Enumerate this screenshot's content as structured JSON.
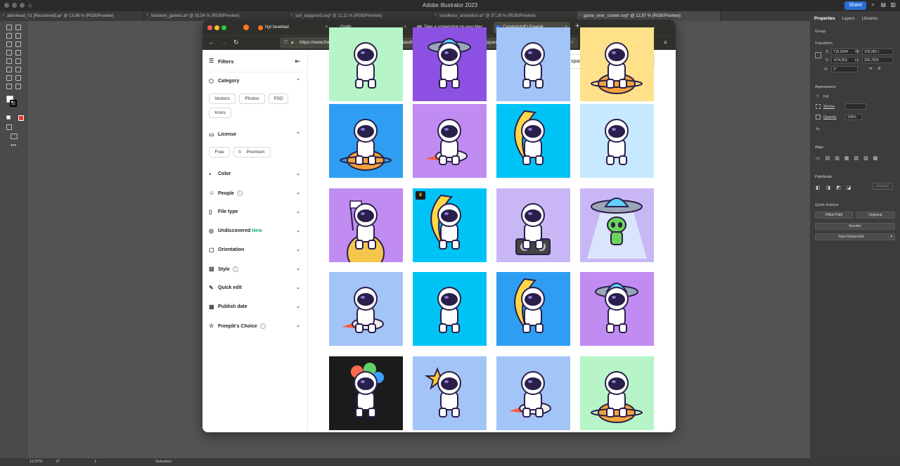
{
  "illustrator": {
    "app_title": "Adobe Illustrator 2023",
    "share_label": "Share",
    "doc_tabs": [
      "alienhead_01 [Recovered].ai* @ 13,66 % (RGB/Preview)",
      "testwork_games.ai* @ 33,54 % (RGB/Preview)",
      "spil_baggrund.svg* @ 11,11 % (RGB/Preview)",
      "sandboxx_animation.ai* @ 37,28 % (RGB/Preview)",
      "game_over_screen.svg* @ 12,97 % (RGB/Preview)"
    ],
    "panel_tabs": [
      "Properties",
      "Layers",
      "Libraries"
    ],
    "panel": {
      "group": "Group",
      "transform": "Transform",
      "x_label": "X:",
      "x_value": "715,0184",
      "w_label": "W:",
      "w_value": "129,282 t",
      "y_label": "Y:",
      "y_value": "-674,353",
      "h_label": "H:",
      "h_value": "209,7026",
      "angle_value": "0°",
      "appearance": "Appearance",
      "fill": "Fill",
      "stroke": "Stroke",
      "opacity": "Opacity",
      "opacity_value": "100%",
      "fx": "fx.",
      "align": "Align",
      "pathfinder": "Pathfinder",
      "expand": "Expand",
      "quick_actions": "Quick Actions",
      "offset_path": "Offset Path",
      "ungroup": "Ungroup",
      "recolor": "Recolor",
      "start_global_edit": "Start Global Edit"
    },
    "status": {
      "zoom": "12,97%",
      "rotation": "0°",
      "artboard": "1",
      "tool": "Selection"
    }
  },
  "browser": {
    "tabs": [
      {
        "label": "Nyt faneblad",
        "active": false
      },
      {
        "label": "Grafic",
        "active": false
      },
      {
        "label": "Take a screenshot on your Mac",
        "active": false
      },
      {
        "label": "Catalyststuff | Freepik",
        "active": true
      }
    ],
    "url": "https://www.freepik.com/search?author=15830015&authorSlug=catalyststuff&format=author&query=space",
    "ext_badge": "2"
  },
  "sidebar": {
    "filters_title": "Filters",
    "category": "Category",
    "category_pills": [
      "Vectors",
      "Photos",
      "PSD",
      "Icons"
    ],
    "license": "License",
    "license_free": "Free",
    "license_premium": "Premium",
    "rows": [
      "Color",
      "People",
      "File type",
      "Undiscovered",
      "Orientation",
      "Style",
      "Quick edit",
      "Publish date",
      "Freepik's Choice"
    ],
    "new_tag": "New"
  },
  "search": {
    "value": "space"
  },
  "grid": {
    "colors": {
      "blue": "#2f9ef2",
      "purple": "#c08cf2",
      "cyan": "#00c3f5",
      "lightblue": "#c7e9ff",
      "lavender": "#c9b7f5",
      "periwinkle": "#a3c4f7",
      "green": "#b7f5c8",
      "yellow": "#ffe18a",
      "dark": "#1b1b1b",
      "violet": "#8c51e3"
    },
    "tiles": [
      {
        "bg": "green",
        "subject": "astronaut-suitcase"
      },
      {
        "bg": "violet",
        "subject": "ufo"
      },
      {
        "bg": "periwinkle",
        "subject": "astronaut"
      },
      {
        "bg": "yellow",
        "subject": "astronaut-planet"
      },
      {
        "bg": "blue",
        "subject": "astronaut-planet"
      },
      {
        "bg": "purple",
        "subject": "astronaut-rocket"
      },
      {
        "bg": "cyan",
        "subject": "astronaut-moon"
      },
      {
        "bg": "lightblue",
        "subject": "astronaut-sleeping"
      },
      {
        "bg": "purple",
        "subject": "astronaut-flag"
      },
      {
        "bg": "cyan",
        "subject": "astronaut-moon",
        "premium": true
      },
      {
        "bg": "lavender",
        "subject": "astronaut-music"
      },
      {
        "bg": "lavender",
        "subject": "alien-ufo"
      },
      {
        "bg": "periwinkle",
        "subject": "astronaut-rocket"
      },
      {
        "bg": "cyan",
        "subject": "astronaut-love"
      },
      {
        "bg": "blue",
        "subject": "astronaut-moon"
      },
      {
        "bg": "purple",
        "subject": "astronaut-ufo"
      },
      {
        "bg": "dark",
        "subject": "astronaut-balloons"
      },
      {
        "bg": "periwinkle",
        "subject": "astronaut-star"
      },
      {
        "bg": "periwinkle",
        "subject": "astronaut-rocket"
      },
      {
        "bg": "green",
        "subject": "astronaut-planet"
      }
    ]
  }
}
